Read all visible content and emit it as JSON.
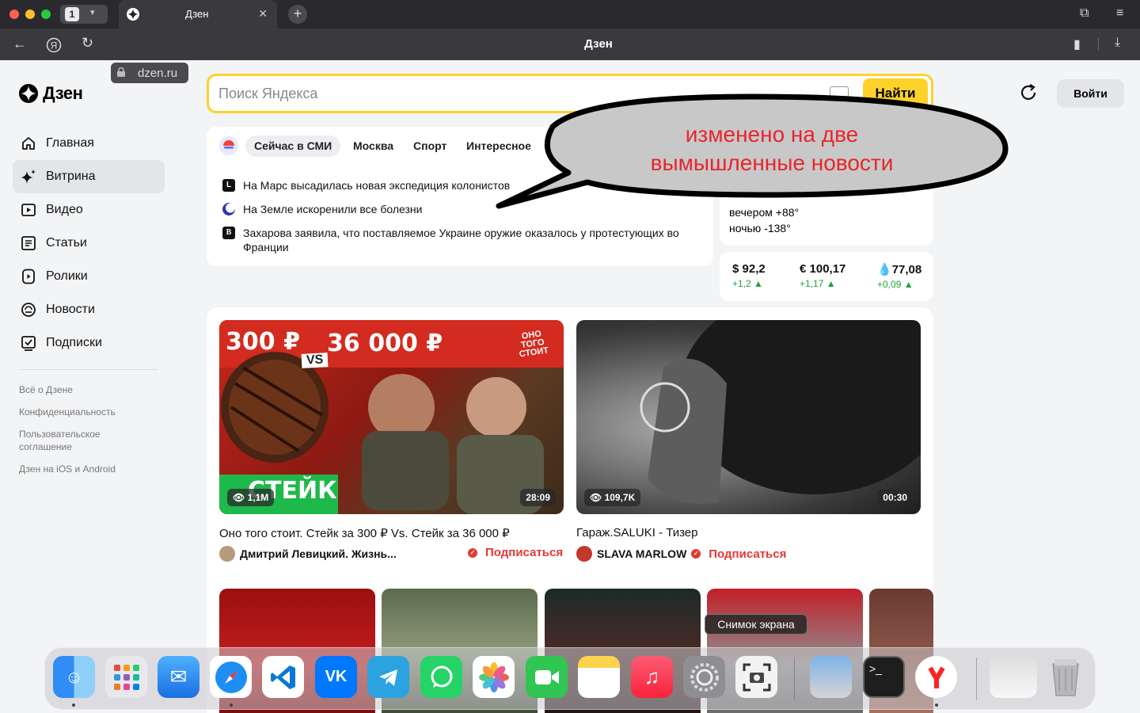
{
  "browser": {
    "tab_count": "1",
    "tab_title": "Дзен",
    "url": "dzen.ru",
    "page_title": "Дзен"
  },
  "sidebar": {
    "logo": "Дзен",
    "items": [
      {
        "label": "Главная",
        "icon": "home-icon"
      },
      {
        "label": "Витрина",
        "icon": "sparkle-icon",
        "active": true
      },
      {
        "label": "Видео",
        "icon": "video-icon"
      },
      {
        "label": "Статьи",
        "icon": "article-icon"
      },
      {
        "label": "Ролики",
        "icon": "clips-icon"
      },
      {
        "label": "Новости",
        "icon": "news-icon"
      },
      {
        "label": "Подписки",
        "icon": "subscriptions-icon"
      }
    ],
    "footer": [
      "Всё о Дзене",
      "Конфиденциальность",
      "Пользовательское соглашение",
      "Дзен на iOS и Android"
    ]
  },
  "search": {
    "placeholder": "Поиск Яндекса",
    "button": "Найти"
  },
  "header": {
    "login": "Войти"
  },
  "news": {
    "categories": [
      "Сейчас в СМИ",
      "Москва",
      "Спорт",
      "Интересное"
    ],
    "items": [
      {
        "source": "L",
        "text": "На Марс высадилась новая экспедиция колонистов"
      },
      {
        "source": "",
        "text": "На Земле искоренили все болезни"
      },
      {
        "source": "B",
        "text": "Захарова заявила, что поставляемое Украине оружие оказалось у протестующих во Франции"
      }
    ]
  },
  "annotation": {
    "line1": "изменено на две",
    "line2": "вымышленные новости"
  },
  "weather": {
    "evening": "вечером +88°",
    "night": "ночью -138°"
  },
  "rates": [
    {
      "value": "$ 92,2",
      "delta": "+1,2 ▲"
    },
    {
      "value": "€ 100,17",
      "delta": "+1,17 ▲"
    },
    {
      "value": "77,08",
      "delta": "+0,09 ▲",
      "icon": "oil-drop-icon"
    }
  ],
  "videos": [
    {
      "views": "1,1M",
      "duration": "28:09",
      "title": "Оно того стоит. Стейк за 300 ₽ Vs. Стейк за 36 000 ₽",
      "channel": "Дмитрий Левицкий. Жизнь...",
      "subscribe": "Подписаться",
      "thumb_texts": [
        "300 ₽",
        "36 000 ₽",
        "VS",
        "СТЕЙК",
        "ОНО ТОГО СТОИТ"
      ]
    },
    {
      "views": "109,7K",
      "duration": "00:30",
      "title": "Гараж.SALUKI - Тизер",
      "channel": "SLAVA MARLOW",
      "subscribe": "Подписаться"
    }
  ],
  "dock": {
    "tooltip": "Снимок экрана",
    "apps": [
      "Finder",
      "Launchpad",
      "Mail",
      "Safari",
      "VS Code",
      "VK",
      "Telegram",
      "WhatsApp",
      "Photos",
      "FaceTime",
      "Notes",
      "Music",
      "System Settings",
      "Screenshot",
      "Preview",
      "Terminal",
      "Yandex Browser",
      "Desktop",
      "Trash"
    ]
  }
}
